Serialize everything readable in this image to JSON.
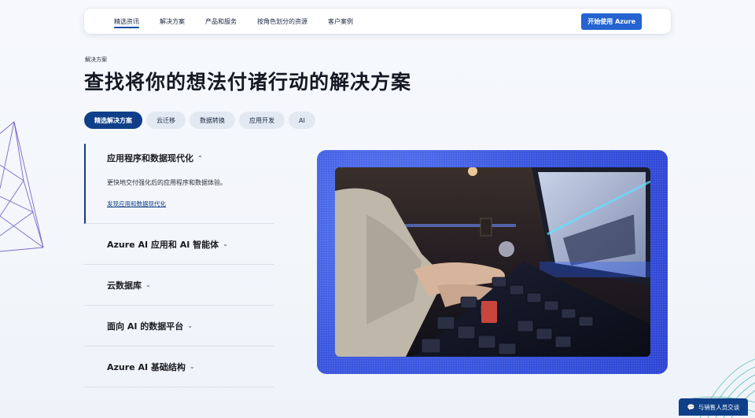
{
  "nav": {
    "items": [
      {
        "label": "精选资讯",
        "active": true
      },
      {
        "label": "解决方案",
        "active": false
      },
      {
        "label": "产品和服务",
        "active": false
      },
      {
        "label": "按角色划分的资源",
        "active": false
      },
      {
        "label": "客户案例",
        "active": false
      }
    ],
    "cta_label": "开始使用 Azure"
  },
  "hero": {
    "eyebrow": "解决方案",
    "headline": "查找将你的想法付诸行动的解决方案"
  },
  "tabs": [
    {
      "label": "精选解决方案",
      "active": true
    },
    {
      "label": "云迁移",
      "active": false
    },
    {
      "label": "数据转换",
      "active": false
    },
    {
      "label": "应用开发",
      "active": false
    },
    {
      "label": "AI",
      "active": false
    }
  ],
  "accordion": {
    "open_item": {
      "title": "应用程序和数据现代化",
      "description": "更快地交付强化后的应用程序和数据体验。",
      "link": "发现应用和数据现代化"
    },
    "items": [
      {
        "title": "Azure AI 应用和 AI 智能体"
      },
      {
        "title": "云数据库"
      },
      {
        "title": "面向 AI 的数据平台"
      },
      {
        "title": "Azure AI 基础结构"
      }
    ]
  },
  "chat": {
    "label": "与销售人员交谈"
  },
  "colors": {
    "primary": "#0f3f88",
    "cta": "#2463d0",
    "media_frame": "#3c58e0"
  }
}
